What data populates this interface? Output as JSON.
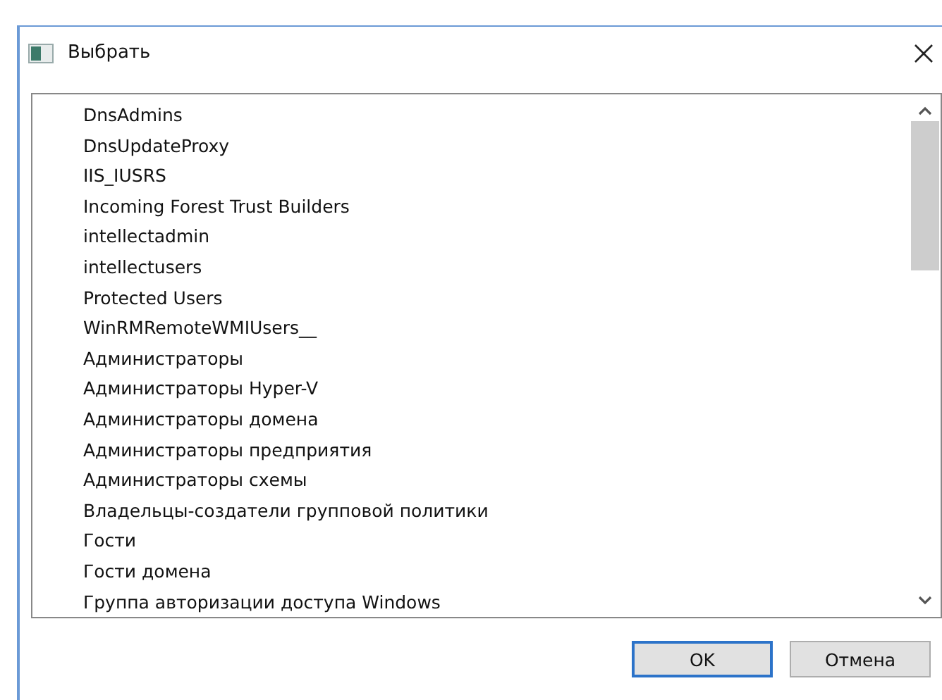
{
  "window": {
    "title": "Выбрать"
  },
  "list": {
    "items": [
      "DnsAdmins",
      "DnsUpdateProxy",
      "IIS_IUSRS",
      "Incoming Forest Trust Builders",
      "intellectadmin",
      "intellectusers",
      "Protected Users",
      "WinRMRemoteWMIUsers__",
      "Администраторы",
      "Администраторы Hyper-V",
      "Администраторы домена",
      "Администраторы предприятия",
      "Администраторы схемы",
      "Владельцы-создатели групповой политики",
      "Гости",
      "Гости домена",
      "Группа авторизации доступа Windows"
    ]
  },
  "buttons": [
    {
      "label": "OK",
      "kind": "default"
    },
    {
      "label": "Отмена",
      "kind": "normal"
    }
  ]
}
